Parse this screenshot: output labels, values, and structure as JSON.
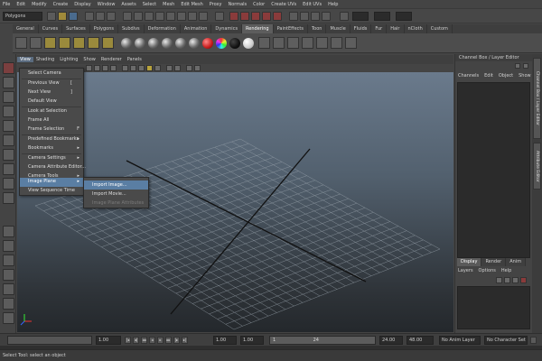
{
  "menubar": [
    "File",
    "Edit",
    "Modify",
    "Create",
    "Display",
    "Window",
    "Assets",
    "Select",
    "Mesh",
    "Edit Mesh",
    "Proxy",
    "Normals",
    "Color",
    "Create UVs",
    "Edit UVs",
    "Help"
  ],
  "toolbar": {
    "mode_value": "Polygons"
  },
  "shelf_tabs": [
    "General",
    "Curves",
    "Surfaces",
    "Polygons",
    "Subdivs",
    "Deformation",
    "Animation",
    "Dynamics",
    "Rendering",
    "PaintEffects",
    "Toon",
    "Muscle",
    "Fluids",
    "Fur",
    "Hair",
    "nCloth",
    "Custom"
  ],
  "shelf_active_tab": "Rendering",
  "panel_menu": [
    "View",
    "Shading",
    "Lighting",
    "Show",
    "Renderer",
    "Panels"
  ],
  "view_menu": {
    "items": [
      {
        "label": "Select Camera"
      },
      {
        "label": "Previous View",
        "key": "["
      },
      {
        "label": "Next View",
        "key": "]"
      },
      {
        "label": "Default View"
      },
      {
        "label": "Look at Selection"
      },
      {
        "label": "Frame All"
      },
      {
        "label": "Frame Selection",
        "key": "F"
      },
      {
        "label": "Predefined Bookmarks",
        "arrow": "▸"
      },
      {
        "label": "Bookmarks",
        "arrow": "▸"
      },
      {
        "label": "Camera Settings",
        "arrow": "▸"
      },
      {
        "label": "Camera Attribute Editor..."
      },
      {
        "label": "Camera Tools",
        "arrow": "▸"
      },
      {
        "label": "Image Plane",
        "arrow": "▸"
      },
      {
        "label": "View Sequence Time"
      }
    ]
  },
  "image_plane_submenu": {
    "items": [
      {
        "label": "Import Image..."
      },
      {
        "label": "Import Movie..."
      },
      {
        "label": "Image Plane Attributes"
      }
    ]
  },
  "channel_box": {
    "title": "Channel Box / Layer Editor",
    "menu": [
      "Channels",
      "Edit",
      "Object",
      "Show"
    ]
  },
  "layer_editor": {
    "tabs": [
      "Display",
      "Render",
      "Anim"
    ],
    "menu": [
      "Layers",
      "Options",
      "Help"
    ]
  },
  "side_tabs": [
    "Channel Box / Layer Editor",
    "Attribute Editor"
  ],
  "timeline": {
    "ruler_value": "1.00",
    "current_frame": "1.00",
    "range_start": "1.00",
    "range_slider_start": "1",
    "range_slider_end": "24",
    "range_end": "24.00",
    "total_end": "48.00",
    "anim_layer": "No Anim Layer",
    "character_set": "No Character Set",
    "playback_buttons": [
      "|◂",
      "◂|",
      "◂◂",
      "◂",
      "▸",
      "▸▸",
      "|▸",
      "▸|"
    ]
  },
  "status": "Select Tool: select an object",
  "colors": {
    "highlight": "#5a7ea3",
    "viewport_top": "#6a7a8c",
    "viewport_bottom": "#24282c"
  }
}
